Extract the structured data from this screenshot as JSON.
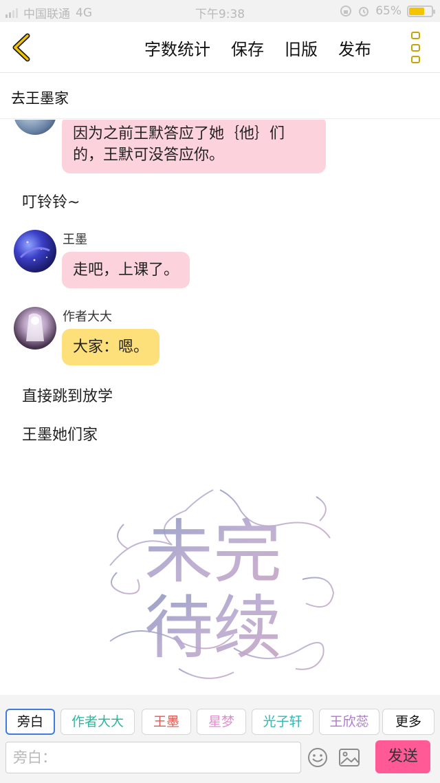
{
  "status_bar": {
    "carrier": "中国联通",
    "network": "4G",
    "time": "下午9:38",
    "battery_percent": "65%",
    "battery_color": "#f5c400"
  },
  "nav": {
    "actions": [
      "字数统计",
      "保存",
      "旧版",
      "发布"
    ],
    "accent": "#c9a400"
  },
  "chapter_title": "去王墨家",
  "messages": {
    "first_bubble": "因为之前王默答应了她｛他｝们\n的，王默可没答应你。",
    "narration_1": "叮铃铃~",
    "msg_wangmo": {
      "speaker": "王墨",
      "text": "走吧，上课了。"
    },
    "msg_author": {
      "speaker": "作者大大",
      "text": "大家：嗯。"
    },
    "narration_2": "直接跳到放学",
    "narration_3": "王墨她们家"
  },
  "end_image": {
    "line1": "未完",
    "line2": "待续"
  },
  "roles": [
    {
      "label": "旁白",
      "color": "#111111"
    },
    {
      "label": "作者大大",
      "color": "#2db79f"
    },
    {
      "label": "王墨",
      "color": "#e2574f"
    },
    {
      "label": "星梦",
      "color": "#e78ad0"
    },
    {
      "label": "光子轩",
      "color": "#31b7b1"
    },
    {
      "label": "王欣蕊",
      "color": "#b274d3"
    },
    {
      "label": "更多",
      "color": "#111111"
    }
  ],
  "input": {
    "placeholder": "旁白：",
    "send_label": "发送"
  }
}
